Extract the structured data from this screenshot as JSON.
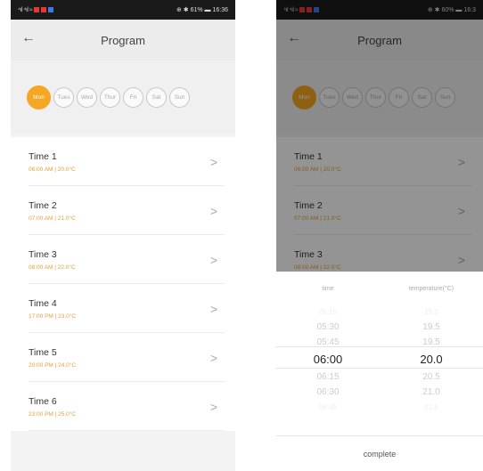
{
  "status": {
    "left_signal": "⁴ıl ⁴ıl ≈",
    "left_right_text": "⊕ ✱ 61% ▬ 16:36",
    "right_signal": "⁴ıl ⁴ıl ≈",
    "right_right_text": "⊕ ✱ 60% ▬ 16:3"
  },
  "appbar": {
    "title": "Program"
  },
  "days": [
    "Mon",
    "Tues",
    "Wed",
    "Thur",
    "Fri",
    "Sat",
    "Sun"
  ],
  "schedule": [
    {
      "name": "Time 1",
      "detail": "06:00 AM | 20.0°C"
    },
    {
      "name": "Time 2",
      "detail": "07:00 AM | 21.0°C"
    },
    {
      "name": "Time 3",
      "detail": "08:00 AM | 22.0°C"
    },
    {
      "name": "Time 4",
      "detail": "17:00 PM | 23.0°C"
    },
    {
      "name": "Time 5",
      "detail": "20:00 PM | 24.0°C"
    },
    {
      "name": "Time 6",
      "detail": "23:00 PM | 25.0°C"
    }
  ],
  "picker": {
    "time_label": "time",
    "temp_label": "temperature(°C)",
    "times": [
      "05:15",
      "05:30",
      "05:45",
      "06:00",
      "06:15",
      "06:30",
      "06:45"
    ],
    "temps": [
      "19.0",
      "19.5",
      "19.5",
      "20.0",
      "20.5",
      "21.0",
      "21.5"
    ],
    "complete_label": "complete"
  }
}
